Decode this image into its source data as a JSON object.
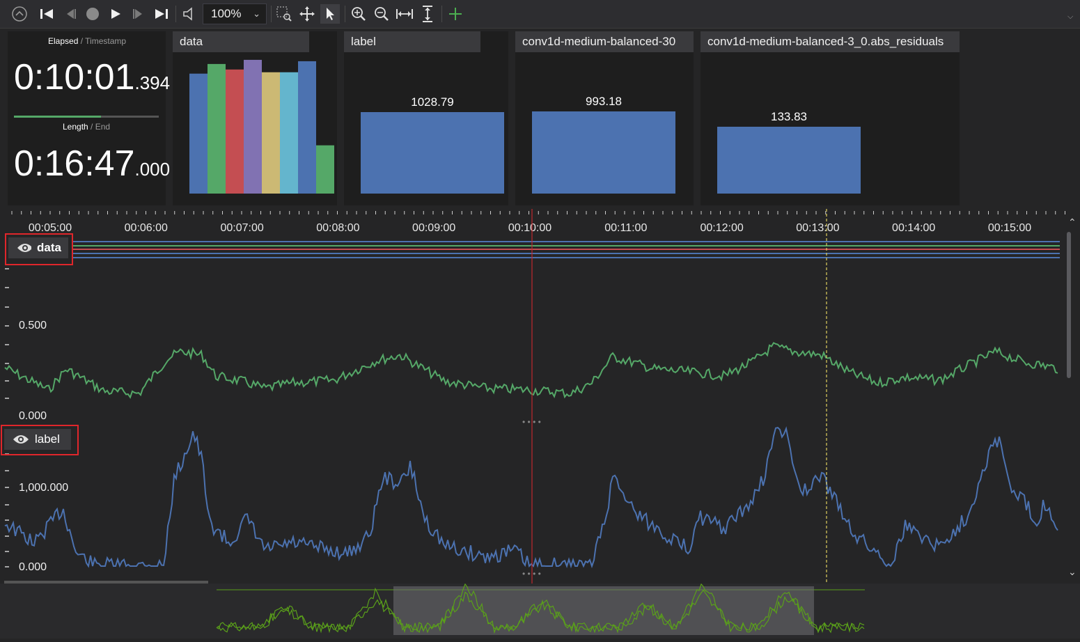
{
  "toolbar": {
    "zoom_value": "100%",
    "icons": [
      "collapse-icon",
      "skip-start-icon",
      "step-back-icon",
      "stop-icon",
      "play-icon",
      "step-forward-icon",
      "skip-end-icon",
      "volume-icon",
      "zoom-rect-icon",
      "pan-icon",
      "select-icon",
      "zoom-in-icon",
      "zoom-out-icon",
      "fit-horizontal-icon",
      "fit-vertical-icon",
      "add-icon"
    ]
  },
  "time_panel": {
    "elapsed_label": "Elapsed",
    "timestamp_label": "Timestamp",
    "elapsed_main": "0:10:01",
    "elapsed_ms": ".394",
    "length_label": "Length",
    "end_label": "End",
    "length_main": "0:16:47",
    "length_ms": ".000",
    "progress": 0.6
  },
  "panels": {
    "data": {
      "title": "data",
      "bars": [
        0.87,
        0.94,
        0.9,
        0.97,
        0.88,
        0.88,
        0.96,
        0.35
      ],
      "colors": [
        "#4c72b0",
        "#55a868",
        "#c44e52",
        "#8172b2",
        "#ccb974",
        "#64b5cd",
        "#4c72b0",
        "#55a868"
      ]
    },
    "label": {
      "title": "label",
      "value": "1028.79"
    },
    "model": {
      "title": "conv1d-medium-balanced-30",
      "value": "993.18"
    },
    "residuals": {
      "title": "conv1d-medium-balanced-3_0.abs_residuals",
      "value": "133.83"
    }
  },
  "timeline": {
    "ticks": [
      "00:05:00",
      "00:06:00",
      "00:07:00",
      "00:08:00",
      "00:09:00",
      "00:10:00",
      "00:11:00",
      "00:12:00",
      "00:13:00",
      "00:14:00",
      "00:15:00"
    ],
    "track_data": {
      "name": "data",
      "y_top": "0.500",
      "y_bottom": "0.000"
    },
    "track_label": {
      "name": "label",
      "y_top": "1,000.000",
      "y_bottom": "0.000"
    }
  },
  "colors": {
    "green": "#55a868",
    "blue": "#4c72b0",
    "cursor": "#c0282d",
    "marker": "#e0d060",
    "minimap": "#5aa01a"
  }
}
